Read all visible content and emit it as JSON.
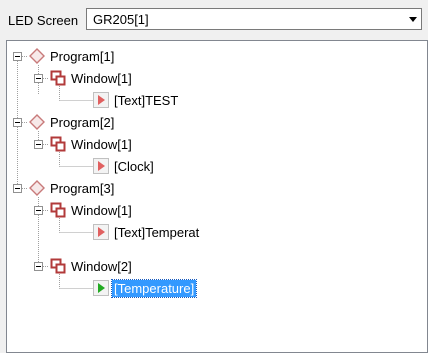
{
  "screen_selector": {
    "label": "LED Screen",
    "value": "GR205[1]"
  },
  "tree": {
    "program1": {
      "label": "Program[1]"
    },
    "program1_window1": {
      "label": "Window[1]"
    },
    "program1_window1_item": {
      "label": "[Text]TEST"
    },
    "program2": {
      "label": "Program[2]"
    },
    "program2_window1": {
      "label": "Window[1]"
    },
    "program2_window1_item": {
      "label": "[Clock]"
    },
    "program3": {
      "label": "Program[3]"
    },
    "program3_window1": {
      "label": "Window[1]"
    },
    "program3_window1_item": {
      "label": "[Text]Temperat"
    },
    "program3_window2": {
      "label": "Window[2]"
    },
    "program3_window2_item": {
      "label": "[Temperature]",
      "selected": true
    }
  },
  "colors": {
    "program_icon": "#c87a7a",
    "window_icon": "#b23a3a",
    "item_icon": "#e06060",
    "item_icon_selected": "#22aa22",
    "selection": "#3399ff"
  }
}
